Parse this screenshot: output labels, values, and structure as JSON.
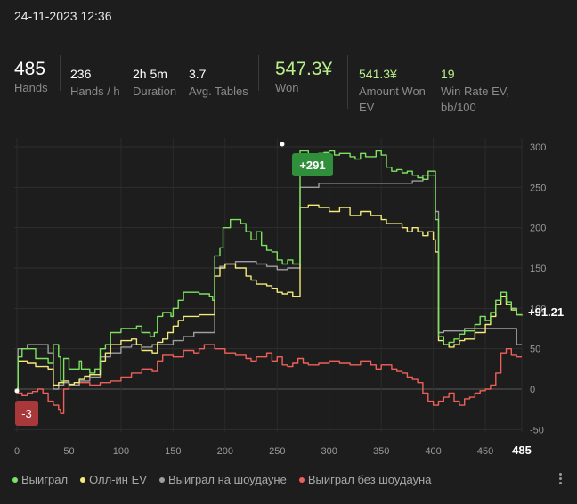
{
  "header": {
    "timestamp": "24-11-2023 12:36"
  },
  "stats": [
    {
      "value": "485",
      "label": "Hands"
    },
    {
      "value": "236",
      "label": "Hands / h"
    },
    {
      "value": "2h 5m",
      "label": "Duration"
    },
    {
      "value": "3.7",
      "label": "Avg. Tables"
    },
    {
      "value": "547.3¥",
      "label": "Won"
    },
    {
      "value": "541.3¥",
      "label_line1": "Amount Won",
      "label_line2": "EV"
    },
    {
      "value": "19",
      "label_line1": "Win Rate EV,",
      "label_line2": "bb/100"
    }
  ],
  "colors": {
    "won": "#7de35f",
    "allin_ev": "#f4ea7a",
    "showdown": "#9e9e9e",
    "non_showdown": "#f0605a",
    "accent_green": "#b9f08b",
    "badge_green": "#2f8f3a",
    "badge_red": "#a8383a"
  },
  "chart_data": {
    "type": "line",
    "xlim": [
      0,
      485
    ],
    "ylim": [
      -55,
      305
    ],
    "x_ticks": [
      0,
      50,
      100,
      150,
      200,
      250,
      300,
      350,
      400,
      450
    ],
    "x_end_label": "485",
    "y_ticks": [
      300,
      250,
      200,
      150,
      100,
      50,
      0,
      -50
    ],
    "annotations": {
      "peak_label": "+291",
      "min_label": "-3",
      "end_label": "+91.21"
    },
    "series": [
      {
        "name": "Выиграл",
        "color": "#7de35f",
        "points": [
          [
            0,
            1
          ],
          [
            1,
            40
          ],
          [
            5,
            50
          ],
          [
            18,
            38
          ],
          [
            30,
            32
          ],
          [
            35,
            55
          ],
          [
            40,
            40
          ],
          [
            42,
            10
          ],
          [
            45,
            38
          ],
          [
            50,
            25
          ],
          [
            55,
            25
          ],
          [
            60,
            35
          ],
          [
            62,
            25
          ],
          [
            70,
            20
          ],
          [
            75,
            25
          ],
          [
            80,
            50
          ],
          [
            85,
            55
          ],
          [
            90,
            70
          ],
          [
            100,
            75
          ],
          [
            115,
            78
          ],
          [
            120,
            70
          ],
          [
            128,
            65
          ],
          [
            132,
            70
          ],
          [
            135,
            90
          ],
          [
            140,
            95
          ],
          [
            148,
            90
          ],
          [
            150,
            100
          ],
          [
            155,
            110
          ],
          [
            160,
            120
          ],
          [
            170,
            120
          ],
          [
            175,
            118
          ],
          [
            180,
            118
          ],
          [
            185,
            115
          ],
          [
            188,
            110
          ],
          [
            190,
            165
          ],
          [
            195,
            175
          ],
          [
            198,
            200
          ],
          [
            205,
            210
          ],
          [
            215,
            205
          ],
          [
            220,
            195
          ],
          [
            225,
            185
          ],
          [
            230,
            195
          ],
          [
            235,
            178
          ],
          [
            240,
            172
          ],
          [
            245,
            170
          ],
          [
            250,
            160
          ],
          [
            255,
            155
          ],
          [
            260,
            160
          ],
          [
            265,
            155
          ],
          [
            270,
            155
          ],
          [
            272,
            295
          ],
          [
            280,
            290
          ],
          [
            290,
            292
          ],
          [
            295,
            293
          ],
          [
            300,
            295
          ],
          [
            305,
            290
          ],
          [
            310,
            292
          ],
          [
            315,
            292
          ],
          [
            320,
            288
          ],
          [
            325,
            285
          ],
          [
            330,
            292
          ],
          [
            335,
            288
          ],
          [
            345,
            295
          ],
          [
            350,
            290
          ],
          [
            355,
            275
          ],
          [
            360,
            270
          ],
          [
            365,
            272
          ],
          [
            370,
            268
          ],
          [
            375,
            270
          ],
          [
            380,
            265
          ],
          [
            385,
            262
          ],
          [
            390,
            260
          ],
          [
            395,
            270
          ],
          [
            400,
            270
          ],
          [
            402,
            210
          ],
          [
            405,
            65
          ],
          [
            410,
            55
          ],
          [
            415,
            58
          ],
          [
            420,
            62
          ],
          [
            425,
            68
          ],
          [
            430,
            72
          ],
          [
            440,
            80
          ],
          [
            445,
            90
          ],
          [
            450,
            85
          ],
          [
            455,
            95
          ],
          [
            460,
            110
          ],
          [
            465,
            120
          ],
          [
            470,
            108
          ],
          [
            475,
            100
          ],
          [
            480,
            92
          ],
          [
            485,
            91
          ]
        ]
      },
      {
        "name": "Олл-ин EV",
        "color": "#f4ea7a",
        "points": [
          [
            0,
            0
          ],
          [
            1,
            35
          ],
          [
            10,
            32
          ],
          [
            18,
            28
          ],
          [
            30,
            25
          ],
          [
            35,
            5
          ],
          [
            40,
            8
          ],
          [
            45,
            10
          ],
          [
            50,
            6
          ],
          [
            55,
            8
          ],
          [
            60,
            12
          ],
          [
            65,
            16
          ],
          [
            70,
            18
          ],
          [
            80,
            35
          ],
          [
            85,
            45
          ],
          [
            90,
            55
          ],
          [
            100,
            60
          ],
          [
            110,
            62
          ],
          [
            115,
            55
          ],
          [
            120,
            48
          ],
          [
            130,
            45
          ],
          [
            135,
            58
          ],
          [
            140,
            62
          ],
          [
            145,
            70
          ],
          [
            150,
            78
          ],
          [
            155,
            85
          ],
          [
            160,
            90
          ],
          [
            175,
            92
          ],
          [
            180,
            92
          ],
          [
            190,
            140
          ],
          [
            195,
            150
          ],
          [
            200,
            155
          ],
          [
            210,
            150
          ],
          [
            220,
            140
          ],
          [
            225,
            135
          ],
          [
            230,
            130
          ],
          [
            240,
            128
          ],
          [
            245,
            125
          ],
          [
            250,
            120
          ],
          [
            255,
            118
          ],
          [
            260,
            120
          ],
          [
            265,
            115
          ],
          [
            270,
            115
          ],
          [
            272,
            225
          ],
          [
            280,
            228
          ],
          [
            290,
            225
          ],
          [
            300,
            220
          ],
          [
            310,
            225
          ],
          [
            320,
            215
          ],
          [
            330,
            220
          ],
          [
            340,
            215
          ],
          [
            350,
            210
          ],
          [
            355,
            205
          ],
          [
            360,
            205
          ],
          [
            370,
            200
          ],
          [
            375,
            195
          ],
          [
            380,
            200
          ],
          [
            385,
            195
          ],
          [
            390,
            190
          ],
          [
            395,
            195
          ],
          [
            400,
            185
          ],
          [
            402,
            170
          ],
          [
            405,
            60
          ],
          [
            410,
            55
          ],
          [
            415,
            52
          ],
          [
            420,
            55
          ],
          [
            425,
            60
          ],
          [
            430,
            62
          ],
          [
            440,
            70
          ],
          [
            450,
            80
          ],
          [
            455,
            90
          ],
          [
            460,
            105
          ],
          [
            465,
            115
          ],
          [
            470,
            105
          ],
          [
            475,
            98
          ],
          [
            480,
            92
          ],
          [
            485,
            91
          ]
        ]
      },
      {
        "name": "Выиграл на шоудауне",
        "color": "#9e9e9e",
        "points": [
          [
            0,
            0
          ],
          [
            1,
            50
          ],
          [
            10,
            55
          ],
          [
            20,
            55
          ],
          [
            30,
            45
          ],
          [
            35,
            0
          ],
          [
            40,
            5
          ],
          [
            45,
            8
          ],
          [
            50,
            5
          ],
          [
            60,
            10
          ],
          [
            70,
            15
          ],
          [
            80,
            40
          ],
          [
            90,
            45
          ],
          [
            100,
            52
          ],
          [
            110,
            55
          ],
          [
            120,
            52
          ],
          [
            130,
            55
          ],
          [
            150,
            60
          ],
          [
            160,
            65
          ],
          [
            170,
            70
          ],
          [
            180,
            70
          ],
          [
            190,
            150
          ],
          [
            195,
            152
          ],
          [
            200,
            155
          ],
          [
            210,
            158
          ],
          [
            220,
            158
          ],
          [
            230,
            155
          ],
          [
            240,
            152
          ],
          [
            250,
            148
          ],
          [
            260,
            150
          ],
          [
            270,
            150
          ],
          [
            272,
            250
          ],
          [
            290,
            255
          ],
          [
            300,
            255
          ],
          [
            320,
            255
          ],
          [
            330,
            255
          ],
          [
            350,
            255
          ],
          [
            360,
            255
          ],
          [
            380,
            258
          ],
          [
            390,
            265
          ],
          [
            400,
            265
          ],
          [
            402,
            220
          ],
          [
            405,
            70
          ],
          [
            410,
            72
          ],
          [
            420,
            72
          ],
          [
            430,
            75
          ],
          [
            440,
            75
          ],
          [
            450,
            75
          ],
          [
            460,
            75
          ],
          [
            470,
            75
          ],
          [
            480,
            55
          ],
          [
            485,
            55
          ]
        ]
      },
      {
        "name": "Выиграл без шоудауна",
        "color": "#f0605a",
        "points": [
          [
            0,
            0
          ],
          [
            1,
            -5
          ],
          [
            5,
            -8
          ],
          [
            10,
            -5
          ],
          [
            15,
            -3
          ],
          [
            20,
            0
          ],
          [
            25,
            -5
          ],
          [
            30,
            -15
          ],
          [
            35,
            -20
          ],
          [
            40,
            -25
          ],
          [
            42,
            -30
          ],
          [
            45,
            0
          ],
          [
            50,
            5
          ],
          [
            60,
            8
          ],
          [
            70,
            5
          ],
          [
            80,
            8
          ],
          [
            90,
            10
          ],
          [
            100,
            15
          ],
          [
            110,
            20
          ],
          [
            120,
            25
          ],
          [
            130,
            22
          ],
          [
            135,
            35
          ],
          [
            140,
            42
          ],
          [
            150,
            40
          ],
          [
            160,
            48
          ],
          [
            170,
            45
          ],
          [
            175,
            50
          ],
          [
            180,
            55
          ],
          [
            190,
            50
          ],
          [
            200,
            45
          ],
          [
            210,
            42
          ],
          [
            220,
            38
          ],
          [
            225,
            35
          ],
          [
            230,
            40
          ],
          [
            240,
            45
          ],
          [
            245,
            35
          ],
          [
            250,
            40
          ],
          [
            255,
            30
          ],
          [
            260,
            28
          ],
          [
            265,
            32
          ],
          [
            270,
            38
          ],
          [
            275,
            32
          ],
          [
            280,
            30
          ],
          [
            290,
            32
          ],
          [
            300,
            35
          ],
          [
            310,
            32
          ],
          [
            320,
            30
          ],
          [
            330,
            35
          ],
          [
            340,
            30
          ],
          [
            345,
            25
          ],
          [
            350,
            30
          ],
          [
            360,
            25
          ],
          [
            365,
            22
          ],
          [
            370,
            20
          ],
          [
            375,
            15
          ],
          [
            380,
            12
          ],
          [
            385,
            8
          ],
          [
            390,
            -5
          ],
          [
            395,
            -15
          ],
          [
            400,
            -20
          ],
          [
            405,
            -15
          ],
          [
            410,
            -10
          ],
          [
            415,
            -5
          ],
          [
            420,
            -15
          ],
          [
            425,
            -20
          ],
          [
            430,
            -12
          ],
          [
            435,
            -10
          ],
          [
            440,
            -5
          ],
          [
            445,
            -2
          ],
          [
            450,
            0
          ],
          [
            455,
            5
          ],
          [
            460,
            20
          ],
          [
            465,
            45
          ],
          [
            470,
            50
          ],
          [
            475,
            42
          ],
          [
            480,
            40
          ],
          [
            485,
            40
          ]
        ]
      }
    ]
  }
}
